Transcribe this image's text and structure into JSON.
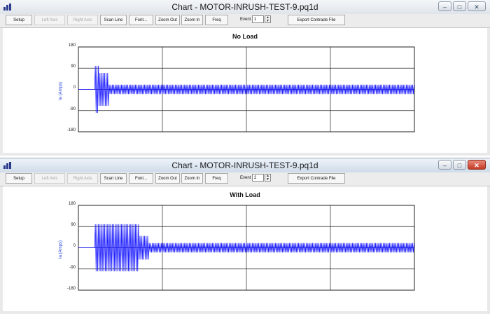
{
  "toolbar": {
    "buttons": [
      {
        "label": "Setup",
        "enabled": true
      },
      {
        "label": "Left Axis",
        "enabled": false
      },
      {
        "label": "Right Axis",
        "enabled": false
      },
      {
        "label": "Scan Line",
        "enabled": true
      },
      {
        "label": "Font...",
        "enabled": true
      },
      {
        "label": "Zoom Out",
        "enabled": true
      },
      {
        "label": "Zoom In",
        "enabled": true
      },
      {
        "label": "Freq",
        "enabled": true
      }
    ],
    "event_label": "Event",
    "export_label": "Export Contrade File"
  },
  "windows": [
    {
      "title": "Chart - MOTOR-INRUSH-TEST-9.pq1d",
      "event_value": "1",
      "active": false,
      "chart_title": "No Load",
      "ylabel": "Ia (Amps)",
      "yticks": [
        "180",
        "90",
        "0",
        "-90",
        "-180"
      ]
    },
    {
      "title": "Chart - MOTOR-INRUSH-TEST-9.pq1d",
      "event_value": "2",
      "active": true,
      "chart_title": "With Load",
      "ylabel": "Ia (Amps)",
      "yticks": [
        "180",
        "90",
        "0",
        "-90",
        "-180"
      ]
    }
  ],
  "chart_data": [
    {
      "type": "line",
      "title": "No Load",
      "ylabel": "Ia (Amps)",
      "ylim": [
        -180,
        180
      ],
      "yticks": [
        180,
        90,
        0,
        -90,
        -180
      ],
      "grid": true,
      "color": "#1a1aff",
      "series": [
        {
          "segments": [
            {
              "x_frac_start": 0.0,
              "x_frac_end": 0.05,
              "amplitude": 0
            },
            {
              "x_frac_start": 0.05,
              "x_frac_end": 0.06,
              "amplitude": 100
            },
            {
              "x_frac_start": 0.06,
              "x_frac_end": 0.09,
              "amplitude": 70
            },
            {
              "x_frac_start": 0.09,
              "x_frac_end": 1.0,
              "amplitude": 20
            }
          ]
        }
      ]
    },
    {
      "type": "line",
      "title": "With Load",
      "ylabel": "Ia (Amps)",
      "ylim": [
        -180,
        180
      ],
      "yticks": [
        180,
        90,
        0,
        -90,
        -180
      ],
      "grid": true,
      "color": "#1a1aff",
      "series": [
        {
          "segments": [
            {
              "x_frac_start": 0.0,
              "x_frac_end": 0.05,
              "amplitude": 0
            },
            {
              "x_frac_start": 0.05,
              "x_frac_end": 0.18,
              "amplitude": 100
            },
            {
              "x_frac_start": 0.18,
              "x_frac_end": 0.21,
              "amplitude": 50
            },
            {
              "x_frac_start": 0.21,
              "x_frac_end": 1.0,
              "amplitude": 20
            }
          ]
        }
      ]
    }
  ]
}
